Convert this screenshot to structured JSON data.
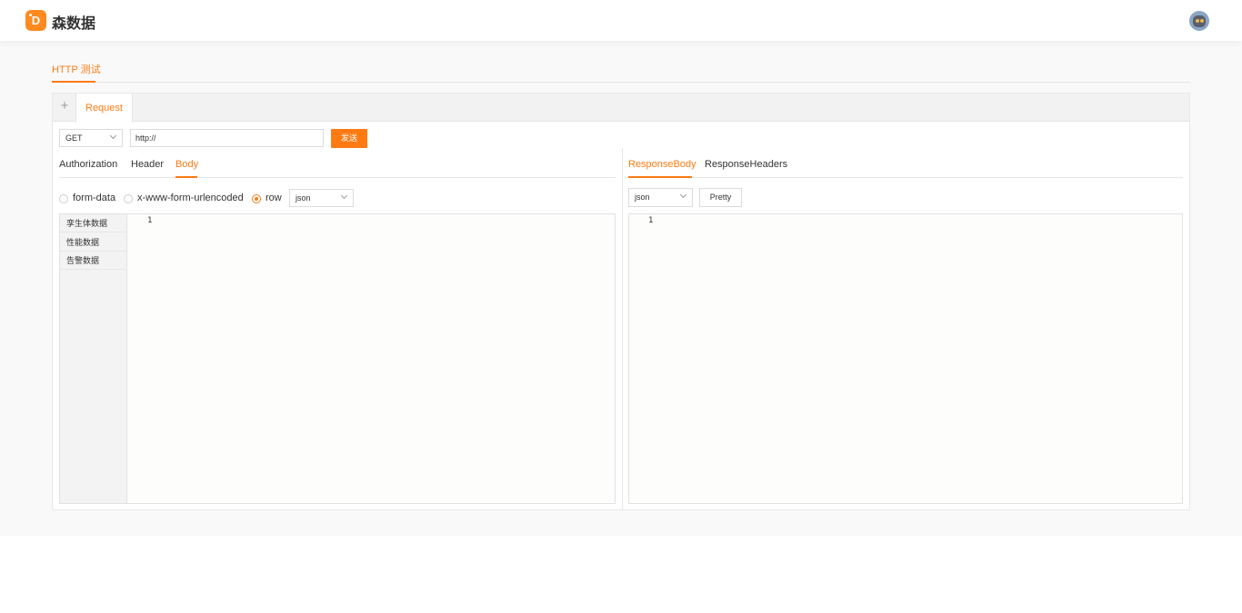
{
  "app": {
    "brand_name": "森数据",
    "accent_color": "#ff7a12"
  },
  "header": {
    "avatar_icon": "user-avatar"
  },
  "nav": {
    "tabs": [
      {
        "label": "HTTP 测试",
        "active": true
      }
    ]
  },
  "request_tabs": {
    "add_icon": "plus-icon",
    "tabs": [
      {
        "label": "Request",
        "active": true
      }
    ]
  },
  "request_line": {
    "method": "GET",
    "url": "http://",
    "send_label": "发送"
  },
  "request": {
    "subtabs": [
      {
        "label": "Authorization",
        "active": false
      },
      {
        "label": "Header",
        "active": false
      },
      {
        "label": "Body",
        "active": true
      }
    ],
    "body_types": [
      {
        "label": "form-data",
        "checked": false
      },
      {
        "label": "x-www-form-urlencoded",
        "checked": false
      },
      {
        "label": "row",
        "checked": true
      }
    ],
    "row_format": "json",
    "templates": [
      "孪生体数据",
      "性能数据",
      "告警数据"
    ],
    "editor": {
      "line_numbers": [
        "1"
      ]
    }
  },
  "response": {
    "subtabs": [
      {
        "label": "ResponseBody",
        "active": true
      },
      {
        "label": "ResponseHeaders",
        "active": false
      }
    ],
    "format": "json",
    "pretty_label": "Pretty",
    "editor": {
      "line_numbers": [
        "1"
      ]
    }
  }
}
